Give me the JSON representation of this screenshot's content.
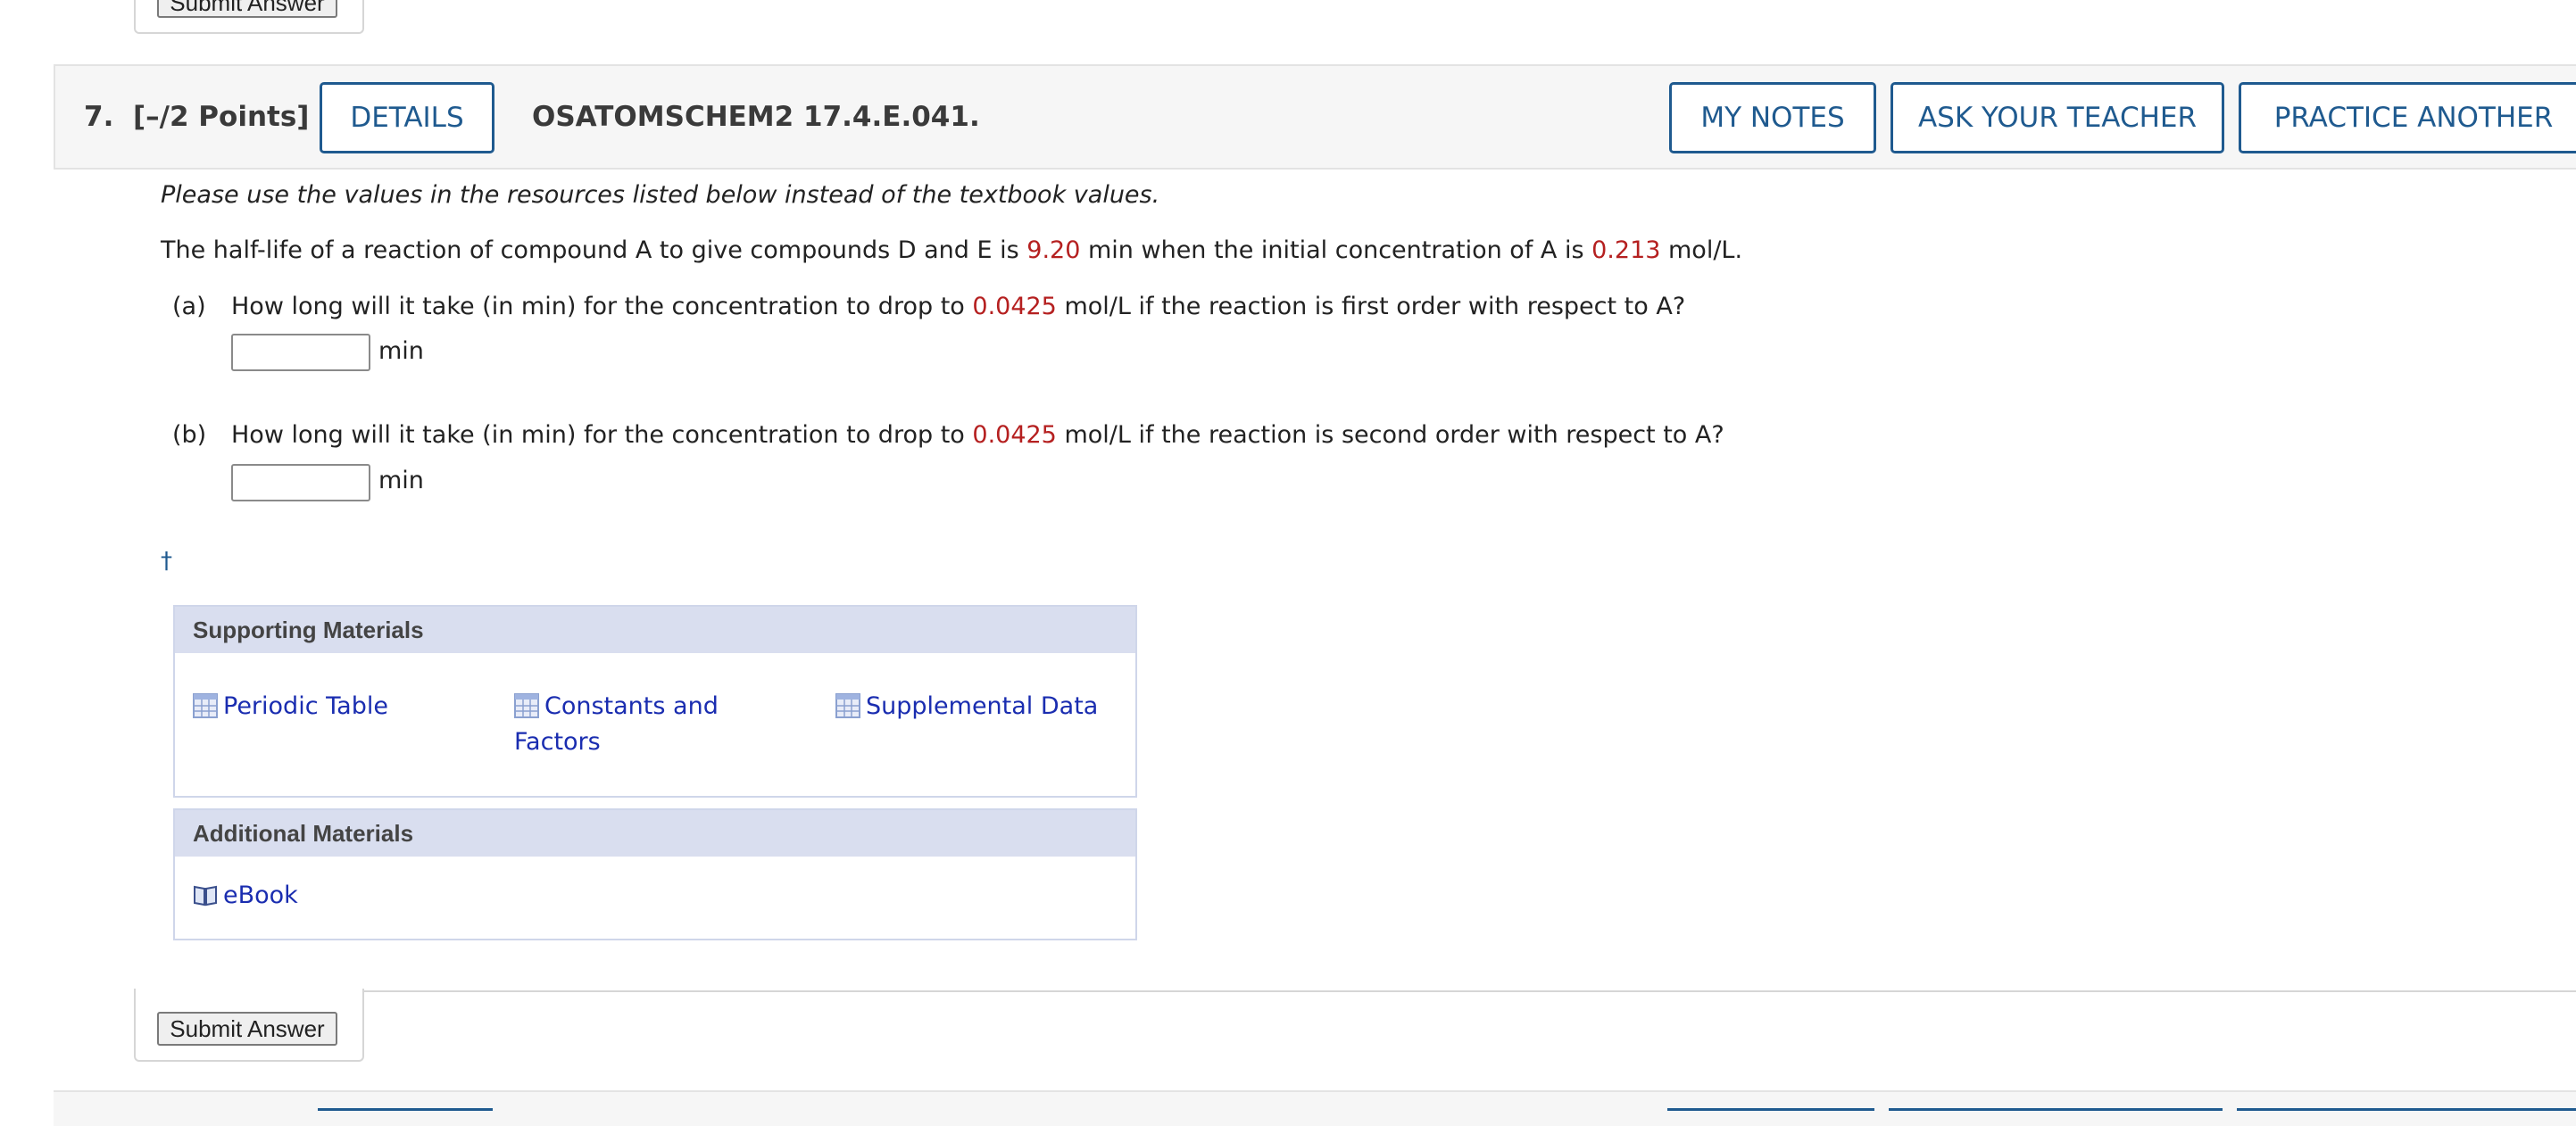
{
  "previous": {
    "submit_label": "Submit Answer"
  },
  "question": {
    "number": "7.",
    "points": "[–/2 Points]",
    "details_label": "DETAILS",
    "code": "OSATOMSCHEM2 17.4.E.041.",
    "my_notes_label": "MY NOTES",
    "ask_teacher_label": "ASK YOUR TEACHER",
    "practice_label": "PRACTICE ANOTHER"
  },
  "instruction": "Please use the values in the resources listed below instead of the textbook values.",
  "statement": {
    "pre": "The half-life of a reaction of compound A to give compounds D and E is ",
    "half_life": "9.20",
    "mid": " min when the initial concentration of A is ",
    "concentration": "0.213",
    "post": " mol/L."
  },
  "parts": [
    {
      "label": "(a)",
      "pre": "How long will it take (in min) for the concentration to drop to ",
      "value": "0.0425",
      "post": " mol/L if the reaction is first order with respect to A?",
      "input_value": "",
      "unit": "min"
    },
    {
      "label": "(b)",
      "pre": "How long will it take (in min) for the concentration to drop to ",
      "value": "0.0425",
      "post": " mol/L if the reaction is second order with respect to A?",
      "input_value": "",
      "unit": "min"
    }
  ],
  "dagger": "†",
  "supporting": {
    "title": "Supporting Materials",
    "links": [
      "Periodic Table",
      "Constants and",
      "Factors",
      "Supplemental Data"
    ]
  },
  "additional": {
    "title": "Additional Materials",
    "links": [
      "eBook"
    ]
  },
  "submit_label": "Submit Answer",
  "colors": {
    "accent": "#1f5a8f",
    "highlight": "#b52020",
    "link": "#1a2db0",
    "panel": "#d9deef"
  }
}
